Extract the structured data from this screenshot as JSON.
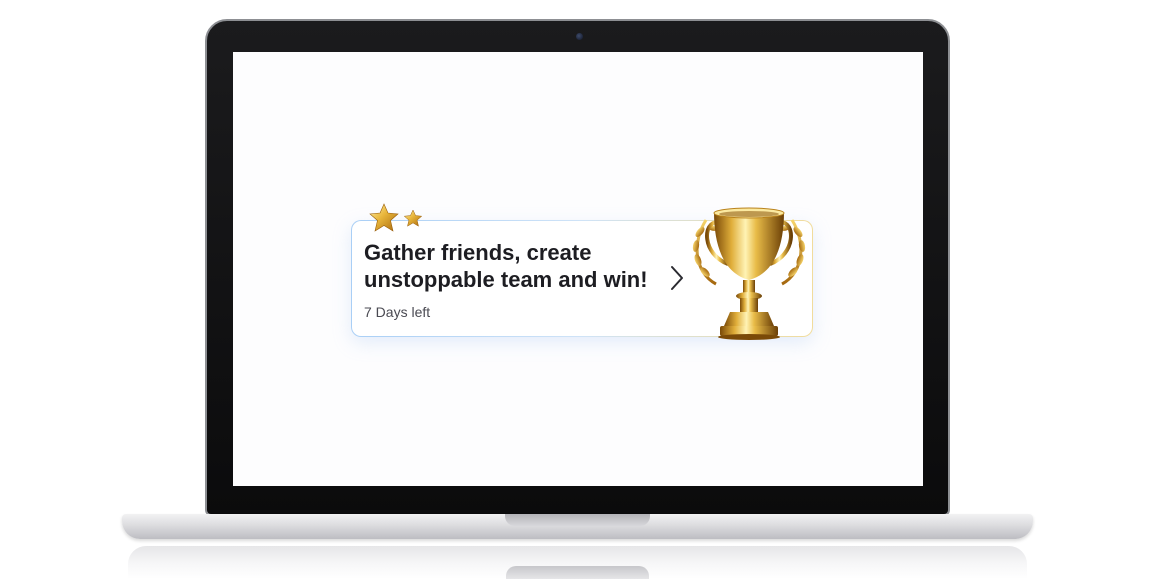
{
  "promo": {
    "title_line1": "Gather friends, create",
    "title_line2": "unstoppable team and win!",
    "days_left": "7 Days left"
  },
  "icons": {
    "chevron": "chevron-right-icon",
    "stars": "star-icon",
    "trophy": "trophy-icon"
  },
  "colors": {
    "title": "#1d1d22",
    "subtitle": "#4a4a52",
    "border_blue": "#a9cff6",
    "border_gold": "#f1dc9c",
    "gold": "#d4a528"
  }
}
